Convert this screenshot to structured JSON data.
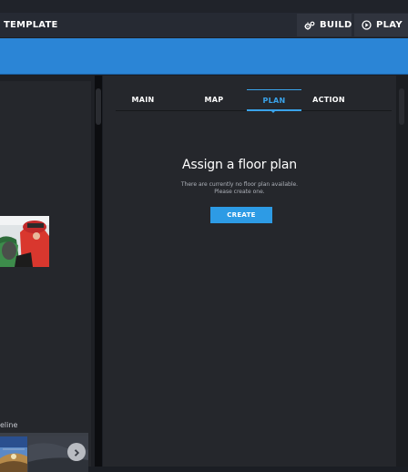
{
  "header": {
    "title": "TEMPLATE",
    "build_label": "BUILD",
    "play_label": "PLAY"
  },
  "left_panel": {
    "timeline_label": "eline"
  },
  "tabs": [
    {
      "label": "MAIN"
    },
    {
      "label": "MAP"
    },
    {
      "label": "PLAN",
      "active": true
    },
    {
      "label": "ACTION"
    }
  ],
  "floor_plan": {
    "title": "Assign a floor plan",
    "message_line1": "There are currently no floor plan available.",
    "message_line2": "Please create one.",
    "create_label": "CREATE"
  },
  "colors": {
    "accent_blue": "#2b85d6",
    "active_tab": "#3aa3ea",
    "create_button": "#2d9be5",
    "panel_bg": "#25272c"
  }
}
